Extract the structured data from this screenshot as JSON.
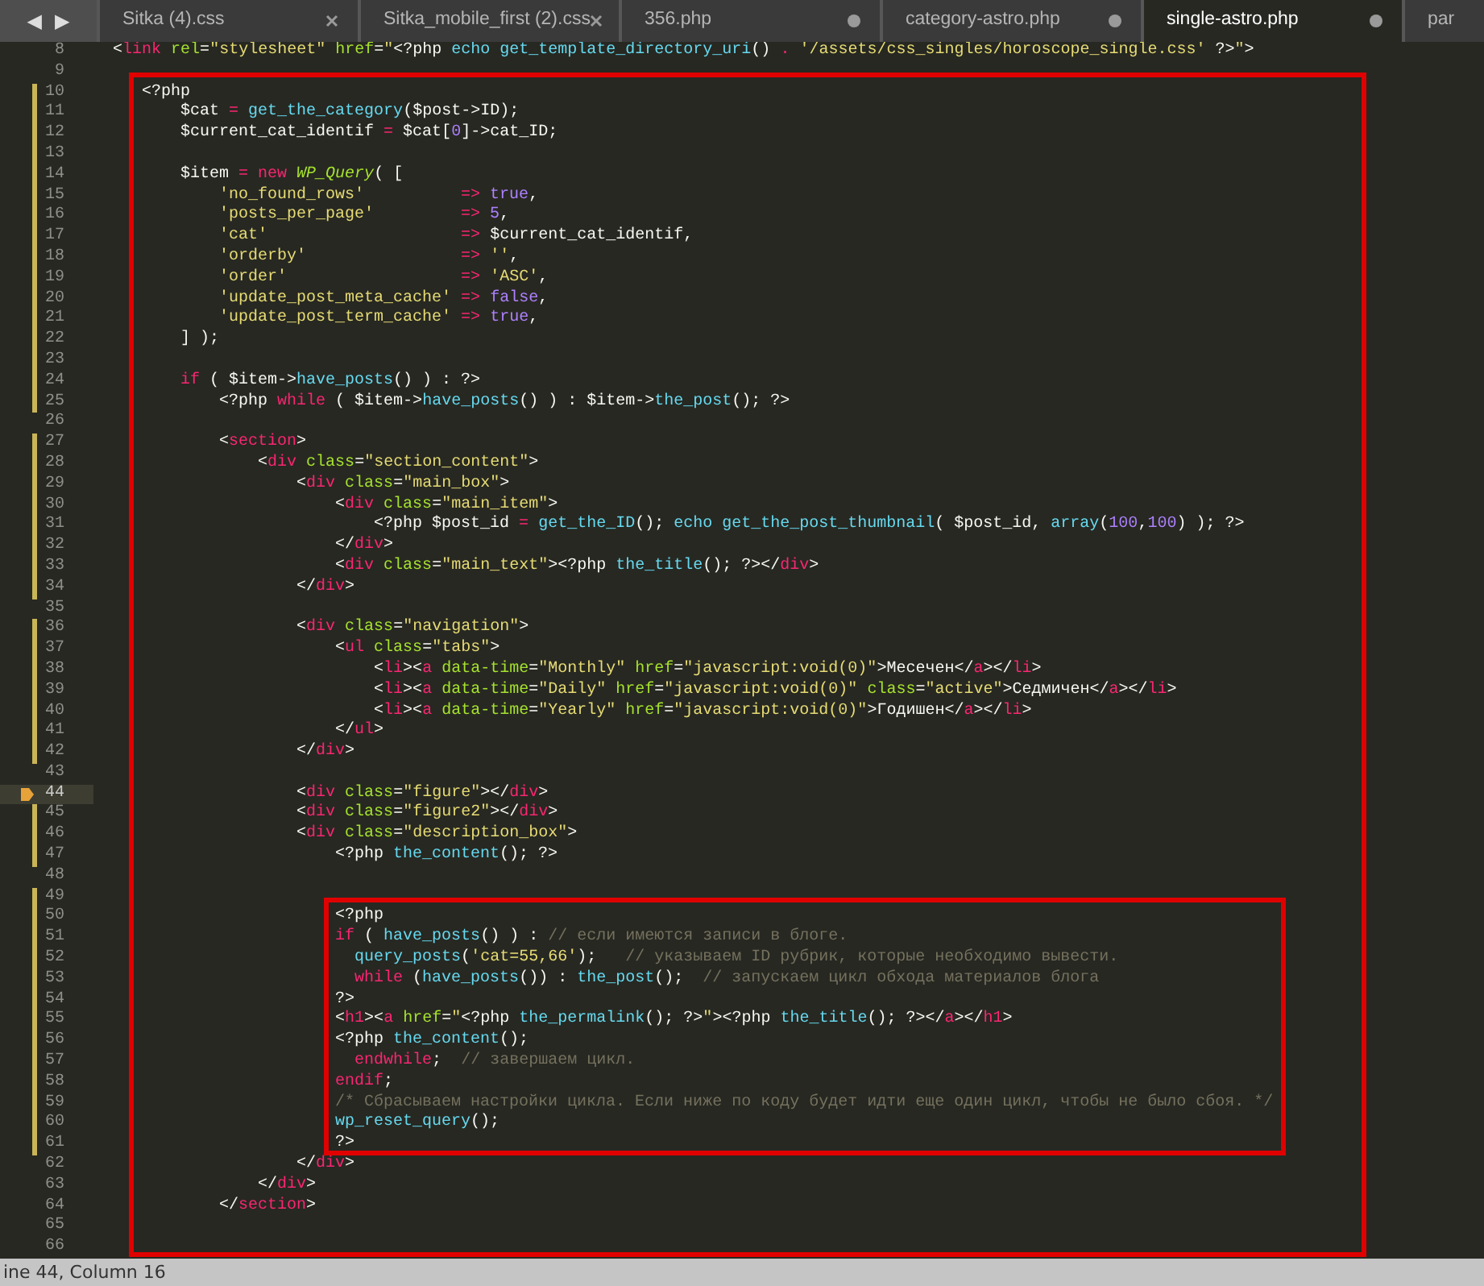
{
  "tab_bar": {
    "nav_arrows": [
      "◀",
      "▶"
    ],
    "tabs": [
      {
        "label": "Sitka (4).css",
        "modified": false,
        "selected": false
      },
      {
        "label": "Sitka_mobile_first (2).css",
        "modified": false,
        "selected": false
      },
      {
        "label": "356.php",
        "modified": true,
        "selected": false
      },
      {
        "label": "category-astro.php",
        "modified": true,
        "selected": false
      },
      {
        "label": "single-astro.php",
        "modified": true,
        "selected": true
      },
      {
        "label": "par",
        "selected": false
      }
    ]
  },
  "editor": {
    "lines": [
      {
        "number": "8",
        "modified": false,
        "current": false,
        "bookmarked": false,
        "frame_starts": false,
        "frame_ends": false,
        "tokens": [
          {
            "kind": "plain",
            "text": "  <"
          },
          {
            "kind": "tag",
            "text": "link"
          },
          {
            "kind": "attr",
            "text": " rel"
          },
          {
            "kind": "plain",
            "text": "="
          },
          {
            "kind": "str",
            "text": "\"stylesheet\""
          },
          {
            "kind": "attr",
            "text": " href"
          },
          {
            "kind": "plain",
            "text": "="
          },
          {
            "kind": "str",
            "text": "\""
          },
          {
            "kind": "plain",
            "text": "<?php "
          },
          {
            "kind": "fn",
            "text": "echo get_template_directory_uri"
          },
          {
            "kind": "plain",
            "text": "() "
          },
          {
            "kind": "op",
            "text": "."
          },
          {
            "kind": "str",
            "text": " '/assets/css_singles/horoscope_single.css'"
          },
          {
            "kind": "plain",
            "text": " ?>"
          },
          {
            "kind": "str",
            "text": "\""
          },
          {
            "kind": "plain",
            "text": ">"
          }
        ]
      },
      {
        "number": "9",
        "modified": false,
        "current": false,
        "bookmarked": false,
        "frame_starts": true,
        "frame_ends": false
      },
      {
        "number": "10",
        "modified": true,
        "current": false,
        "bookmarked": false,
        "frame_starts": false,
        "frame_ends": false,
        "tokens": [
          {
            "kind": "plain",
            "text": "     <?php"
          }
        ]
      },
      {
        "number": "11",
        "modified": true,
        "current": false,
        "bookmarked": false,
        "frame_starts": false,
        "frame_ends": false,
        "tokens": [
          {
            "kind": "plain",
            "text": "         $cat "
          },
          {
            "kind": "op",
            "text": "="
          },
          {
            "kind": "fn",
            "text": " get_the_category"
          },
          {
            "kind": "plain",
            "text": "($post->ID);"
          }
        ]
      },
      {
        "number": "12",
        "modified": true,
        "current": false,
        "bookmarked": false,
        "frame_starts": false,
        "frame_ends": false,
        "tokens": [
          {
            "kind": "plain",
            "text": "         $current_cat_identif "
          },
          {
            "kind": "op",
            "text": "="
          },
          {
            "kind": "plain",
            "text": " $cat["
          },
          {
            "kind": "num",
            "text": "0"
          },
          {
            "kind": "plain",
            "text": "]->cat_ID;"
          }
        ]
      },
      {
        "number": "13",
        "modified": true,
        "current": false,
        "bookmarked": false,
        "frame_starts": false,
        "frame_ends": false
      },
      {
        "number": "14",
        "modified": true,
        "current": false,
        "bookmarked": false,
        "frame_starts": false,
        "frame_ends": false,
        "tokens": [
          {
            "kind": "plain",
            "text": "         $item "
          },
          {
            "kind": "op",
            "text": "="
          },
          {
            "kind": "kw",
            "text": " new"
          },
          {
            "kind": "cls",
            "text": " WP_Query"
          },
          {
            "kind": "plain",
            "text": "( ["
          }
        ]
      },
      {
        "number": "15",
        "modified": true,
        "current": false,
        "bookmarked": false,
        "frame_starts": false,
        "frame_ends": false,
        "tokens": [
          {
            "kind": "str",
            "text": "             'no_found_rows'"
          },
          {
            "kind": "op",
            "text": "          =>"
          },
          {
            "kind": "num",
            "text": " true"
          },
          {
            "kind": "plain",
            "text": ","
          }
        ]
      },
      {
        "number": "16",
        "modified": true,
        "current": false,
        "bookmarked": false,
        "frame_starts": false,
        "frame_ends": false,
        "tokens": [
          {
            "kind": "str",
            "text": "             'posts_per_page'"
          },
          {
            "kind": "op",
            "text": "         =>"
          },
          {
            "kind": "num",
            "text": " 5"
          },
          {
            "kind": "plain",
            "text": ","
          }
        ]
      },
      {
        "number": "17",
        "modified": true,
        "current": false,
        "bookmarked": false,
        "frame_starts": false,
        "frame_ends": false,
        "tokens": [
          {
            "kind": "str",
            "text": "             'cat'"
          },
          {
            "kind": "op",
            "text": "                    =>"
          },
          {
            "kind": "plain",
            "text": " $current_cat_identif,"
          }
        ]
      },
      {
        "number": "18",
        "modified": true,
        "current": false,
        "bookmarked": false,
        "frame_starts": false,
        "frame_ends": false,
        "tokens": [
          {
            "kind": "str",
            "text": "             'orderby'"
          },
          {
            "kind": "op",
            "text": "                =>"
          },
          {
            "kind": "str",
            "text": " ''"
          },
          {
            "kind": "plain",
            "text": ","
          }
        ]
      },
      {
        "number": "19",
        "modified": true,
        "current": false,
        "bookmarked": false,
        "frame_starts": false,
        "frame_ends": false,
        "tokens": [
          {
            "kind": "str",
            "text": "             'order'"
          },
          {
            "kind": "op",
            "text": "                  =>"
          },
          {
            "kind": "str",
            "text": " 'ASC'"
          },
          {
            "kind": "plain",
            "text": ","
          }
        ]
      },
      {
        "number": "20",
        "modified": true,
        "current": false,
        "bookmarked": false,
        "frame_starts": false,
        "frame_ends": false,
        "tokens": [
          {
            "kind": "str",
            "text": "             'update_post_meta_cache'"
          },
          {
            "kind": "op",
            "text": " =>"
          },
          {
            "kind": "num",
            "text": " false"
          },
          {
            "kind": "plain",
            "text": ","
          }
        ]
      },
      {
        "number": "21",
        "modified": true,
        "current": false,
        "bookmarked": false,
        "frame_starts": false,
        "frame_ends": false,
        "tokens": [
          {
            "kind": "str",
            "text": "             'update_post_term_cache'"
          },
          {
            "kind": "op",
            "text": " =>"
          },
          {
            "kind": "num",
            "text": " true"
          },
          {
            "kind": "plain",
            "text": ","
          }
        ]
      },
      {
        "number": "22",
        "modified": true,
        "current": false,
        "bookmarked": false,
        "frame_starts": false,
        "frame_ends": false,
        "tokens": [
          {
            "kind": "plain",
            "text": "         ] );"
          }
        ]
      },
      {
        "number": "23",
        "modified": true,
        "current": false,
        "bookmarked": false,
        "frame_starts": false,
        "frame_ends": false
      },
      {
        "number": "24",
        "modified": true,
        "current": false,
        "bookmarked": false,
        "frame_starts": false,
        "frame_ends": false,
        "tokens": [
          {
            "kind": "kw",
            "text": "         if"
          },
          {
            "kind": "plain",
            "text": " ( $item->"
          },
          {
            "kind": "fn",
            "text": "have_posts"
          },
          {
            "kind": "plain",
            "text": "() ) : ?>"
          }
        ]
      },
      {
        "number": "25",
        "modified": true,
        "current": false,
        "bookmarked": false,
        "frame_starts": false,
        "frame_ends": false,
        "tokens": [
          {
            "kind": "plain",
            "text": "             <?php "
          },
          {
            "kind": "kw",
            "text": "while"
          },
          {
            "kind": "plain",
            "text": " ( $item->"
          },
          {
            "kind": "fn",
            "text": "have_posts"
          },
          {
            "kind": "plain",
            "text": "() ) : $item->"
          },
          {
            "kind": "fn",
            "text": "the_post"
          },
          {
            "kind": "plain",
            "text": "(); ?>"
          }
        ]
      },
      {
        "number": "26",
        "modified": false,
        "current": false,
        "bookmarked": false,
        "frame_starts": false,
        "frame_ends": false
      },
      {
        "number": "27",
        "modified": true,
        "current": false,
        "bookmarked": false,
        "frame_starts": false,
        "frame_ends": false,
        "tokens": [
          {
            "kind": "plain",
            "text": "             <"
          },
          {
            "kind": "tag",
            "text": "section"
          },
          {
            "kind": "plain",
            "text": ">"
          }
        ]
      },
      {
        "number": "28",
        "modified": true,
        "current": false,
        "bookmarked": false,
        "frame_starts": false,
        "frame_ends": false,
        "tokens": [
          {
            "kind": "plain",
            "text": "                 <"
          },
          {
            "kind": "tag",
            "text": "div"
          },
          {
            "kind": "attr",
            "text": " class"
          },
          {
            "kind": "plain",
            "text": "="
          },
          {
            "kind": "str",
            "text": "\"section_content\""
          },
          {
            "kind": "plain",
            "text": ">"
          }
        ]
      },
      {
        "number": "29",
        "modified": true,
        "current": false,
        "bookmarked": false,
        "frame_starts": false,
        "frame_ends": false,
        "tokens": [
          {
            "kind": "plain",
            "text": "                     <"
          },
          {
            "kind": "tag",
            "text": "div"
          },
          {
            "kind": "attr",
            "text": " class"
          },
          {
            "kind": "plain",
            "text": "="
          },
          {
            "kind": "str",
            "text": "\"main_box\""
          },
          {
            "kind": "plain",
            "text": ">"
          }
        ]
      },
      {
        "number": "30",
        "modified": true,
        "current": false,
        "bookmarked": false,
        "frame_starts": false,
        "frame_ends": false,
        "tokens": [
          {
            "kind": "plain",
            "text": "                         <"
          },
          {
            "kind": "tag",
            "text": "div"
          },
          {
            "kind": "attr",
            "text": " class"
          },
          {
            "kind": "plain",
            "text": "="
          },
          {
            "kind": "str",
            "text": "\"main_item\""
          },
          {
            "kind": "plain",
            "text": ">"
          }
        ]
      },
      {
        "number": "31",
        "modified": true,
        "current": false,
        "bookmarked": false,
        "frame_starts": false,
        "frame_ends": false,
        "tokens": [
          {
            "kind": "plain",
            "text": "                             <?php $post_id "
          },
          {
            "kind": "op",
            "text": "="
          },
          {
            "kind": "fn",
            "text": " get_the_ID"
          },
          {
            "kind": "plain",
            "text": "(); "
          },
          {
            "kind": "fn",
            "text": "echo get_the_post_thumbnail"
          },
          {
            "kind": "plain",
            "text": "( $post_id, "
          },
          {
            "kind": "fn",
            "text": "array"
          },
          {
            "kind": "plain",
            "text": "("
          },
          {
            "kind": "num",
            "text": "100"
          },
          {
            "kind": "plain",
            "text": ","
          },
          {
            "kind": "num",
            "text": "100"
          },
          {
            "kind": "plain",
            "text": ") ); ?>"
          }
        ]
      },
      {
        "number": "32",
        "modified": true,
        "current": false,
        "bookmarked": false,
        "frame_starts": false,
        "frame_ends": false,
        "tokens": [
          {
            "kind": "plain",
            "text": "                         </"
          },
          {
            "kind": "tag",
            "text": "div"
          },
          {
            "kind": "plain",
            "text": ">"
          }
        ]
      },
      {
        "number": "33",
        "modified": true,
        "current": false,
        "bookmarked": false,
        "frame_starts": false,
        "frame_ends": false,
        "tokens": [
          {
            "kind": "plain",
            "text": "                         <"
          },
          {
            "kind": "tag",
            "text": "div"
          },
          {
            "kind": "attr",
            "text": " class"
          },
          {
            "kind": "plain",
            "text": "="
          },
          {
            "kind": "str",
            "text": "\"main_text\""
          },
          {
            "kind": "plain",
            "text": "><?php "
          },
          {
            "kind": "fn",
            "text": "the_title"
          },
          {
            "kind": "plain",
            "text": "(); ?></"
          },
          {
            "kind": "tag",
            "text": "div"
          },
          {
            "kind": "plain",
            "text": ">"
          }
        ]
      },
      {
        "number": "34",
        "modified": true,
        "current": false,
        "bookmarked": false,
        "frame_starts": false,
        "frame_ends": false,
        "tokens": [
          {
            "kind": "plain",
            "text": "                     </"
          },
          {
            "kind": "tag",
            "text": "div"
          },
          {
            "kind": "plain",
            "text": ">"
          }
        ]
      },
      {
        "number": "35",
        "modified": false,
        "current": false,
        "bookmarked": false,
        "frame_starts": false,
        "frame_ends": false
      },
      {
        "number": "36",
        "modified": true,
        "current": false,
        "bookmarked": false,
        "frame_starts": false,
        "frame_ends": false,
        "tokens": [
          {
            "kind": "plain",
            "text": "                     <"
          },
          {
            "kind": "tag",
            "text": "div"
          },
          {
            "kind": "attr",
            "text": " class"
          },
          {
            "kind": "plain",
            "text": "="
          },
          {
            "kind": "str",
            "text": "\"navigation\""
          },
          {
            "kind": "plain",
            "text": ">"
          }
        ]
      },
      {
        "number": "37",
        "modified": true,
        "current": false,
        "bookmarked": false,
        "frame_starts": false,
        "frame_ends": false,
        "tokens": [
          {
            "kind": "plain",
            "text": "                         <"
          },
          {
            "kind": "tag",
            "text": "ul"
          },
          {
            "kind": "attr",
            "text": " class"
          },
          {
            "kind": "plain",
            "text": "="
          },
          {
            "kind": "str",
            "text": "\"tabs\""
          },
          {
            "kind": "plain",
            "text": ">"
          }
        ]
      },
      {
        "number": "38",
        "modified": true,
        "current": false,
        "bookmarked": false,
        "frame_starts": false,
        "frame_ends": false,
        "tokens": [
          {
            "kind": "plain",
            "text": "                             <"
          },
          {
            "kind": "tag",
            "text": "li"
          },
          {
            "kind": "plain",
            "text": "><"
          },
          {
            "kind": "tag",
            "text": "a"
          },
          {
            "kind": "attr",
            "text": " data-time"
          },
          {
            "kind": "plain",
            "text": "="
          },
          {
            "kind": "str",
            "text": "\"Monthly\""
          },
          {
            "kind": "attr",
            "text": " href"
          },
          {
            "kind": "plain",
            "text": "="
          },
          {
            "kind": "str",
            "text": "\"javascript:void(0)\""
          },
          {
            "kind": "plain",
            "text": ">Месечен</"
          },
          {
            "kind": "tag",
            "text": "a"
          },
          {
            "kind": "plain",
            "text": "></"
          },
          {
            "kind": "tag",
            "text": "li"
          },
          {
            "kind": "plain",
            "text": ">"
          }
        ]
      },
      {
        "number": "39",
        "modified": true,
        "current": false,
        "bookmarked": false,
        "frame_starts": false,
        "frame_ends": false,
        "tokens": [
          {
            "kind": "plain",
            "text": "                             <"
          },
          {
            "kind": "tag",
            "text": "li"
          },
          {
            "kind": "plain",
            "text": "><"
          },
          {
            "kind": "tag",
            "text": "a"
          },
          {
            "kind": "attr",
            "text": " data-time"
          },
          {
            "kind": "plain",
            "text": "="
          },
          {
            "kind": "str",
            "text": "\"Daily\""
          },
          {
            "kind": "attr",
            "text": " href"
          },
          {
            "kind": "plain",
            "text": "="
          },
          {
            "kind": "str",
            "text": "\"javascript:void(0)\""
          },
          {
            "kind": "attr",
            "text": " class"
          },
          {
            "kind": "plain",
            "text": "="
          },
          {
            "kind": "str",
            "text": "\"active\""
          },
          {
            "kind": "plain",
            "text": ">Седмичен</"
          },
          {
            "kind": "tag",
            "text": "a"
          },
          {
            "kind": "plain",
            "text": "></"
          },
          {
            "kind": "tag",
            "text": "li"
          },
          {
            "kind": "plain",
            "text": ">"
          }
        ]
      },
      {
        "number": "40",
        "modified": true,
        "current": false,
        "bookmarked": false,
        "frame_starts": false,
        "frame_ends": false,
        "tokens": [
          {
            "kind": "plain",
            "text": "                             <"
          },
          {
            "kind": "tag",
            "text": "li"
          },
          {
            "kind": "plain",
            "text": "><"
          },
          {
            "kind": "tag",
            "text": "a"
          },
          {
            "kind": "attr",
            "text": " data-time"
          },
          {
            "kind": "plain",
            "text": "="
          },
          {
            "kind": "str",
            "text": "\"Yearly\""
          },
          {
            "kind": "attr",
            "text": " href"
          },
          {
            "kind": "plain",
            "text": "="
          },
          {
            "kind": "str",
            "text": "\"javascript:void(0)\""
          },
          {
            "kind": "plain",
            "text": ">Годишен</"
          },
          {
            "kind": "tag",
            "text": "a"
          },
          {
            "kind": "plain",
            "text": "></"
          },
          {
            "kind": "tag",
            "text": "li"
          },
          {
            "kind": "plain",
            "text": ">"
          }
        ]
      },
      {
        "number": "41",
        "modified": true,
        "current": false,
        "bookmarked": false,
        "frame_starts": false,
        "frame_ends": false,
        "tokens": [
          {
            "kind": "plain",
            "text": "                         </"
          },
          {
            "kind": "tag",
            "text": "ul"
          },
          {
            "kind": "plain",
            "text": ">"
          }
        ]
      },
      {
        "number": "42",
        "modified": true,
        "current": false,
        "bookmarked": false,
        "frame_starts": false,
        "frame_ends": false,
        "tokens": [
          {
            "kind": "plain",
            "text": "                     </"
          },
          {
            "kind": "tag",
            "text": "div"
          },
          {
            "kind": "plain",
            "text": ">"
          }
        ]
      },
      {
        "number": "43",
        "modified": false,
        "current": false,
        "bookmarked": false,
        "frame_starts": false,
        "frame_ends": false
      },
      {
        "number": "44",
        "modified": false,
        "current": true,
        "bookmarked": true,
        "frame_starts": false,
        "frame_ends": false,
        "tokens": [
          {
            "kind": "plain",
            "text": "                     <"
          },
          {
            "kind": "tag",
            "text": "div"
          },
          {
            "kind": "attr",
            "text": " class"
          },
          {
            "kind": "plain",
            "text": "="
          },
          {
            "kind": "str",
            "text": "\"figure\""
          },
          {
            "kind": "plain",
            "text": "></"
          },
          {
            "kind": "tag",
            "text": "div"
          },
          {
            "kind": "plain",
            "text": ">"
          }
        ]
      },
      {
        "number": "45",
        "modified": true,
        "current": false,
        "bookmarked": false,
        "frame_starts": false,
        "frame_ends": false,
        "tokens": [
          {
            "kind": "plain",
            "text": "                     <"
          },
          {
            "kind": "tag",
            "text": "div"
          },
          {
            "kind": "attr",
            "text": " class"
          },
          {
            "kind": "plain",
            "text": "="
          },
          {
            "kind": "str",
            "text": "\"figure2\""
          },
          {
            "kind": "plain",
            "text": "></"
          },
          {
            "kind": "tag",
            "text": "div"
          },
          {
            "kind": "plain",
            "text": ">"
          }
        ]
      },
      {
        "number": "46",
        "modified": true,
        "current": false,
        "bookmarked": false,
        "frame_starts": false,
        "frame_ends": false,
        "tokens": [
          {
            "kind": "plain",
            "text": "                     <"
          },
          {
            "kind": "tag",
            "text": "div"
          },
          {
            "kind": "attr",
            "text": " class"
          },
          {
            "kind": "plain",
            "text": "="
          },
          {
            "kind": "str",
            "text": "\"description_box\""
          },
          {
            "kind": "plain",
            "text": ">"
          }
        ]
      },
      {
        "number": "47",
        "modified": true,
        "current": false,
        "bookmarked": false,
        "frame_starts": false,
        "frame_ends": false,
        "tokens": [
          {
            "kind": "plain",
            "text": "                         <?php "
          },
          {
            "kind": "fn",
            "text": "the_content"
          },
          {
            "kind": "plain",
            "text": "(); ?>"
          }
        ]
      },
      {
        "number": "48",
        "modified": false,
        "current": false,
        "bookmarked": false,
        "frame_starts": false,
        "frame_ends": false
      },
      {
        "number": "49",
        "modified": true,
        "current": false,
        "bookmarked": false,
        "frame_starts": true,
        "frame_ends": false
      },
      {
        "number": "50",
        "modified": true,
        "current": false,
        "bookmarked": false,
        "frame_starts": false,
        "frame_ends": false,
        "tokens": [
          {
            "kind": "plain",
            "text": "                         <?php"
          }
        ]
      },
      {
        "number": "51",
        "modified": true,
        "current": false,
        "bookmarked": false,
        "frame_starts": false,
        "frame_ends": false,
        "tokens": [
          {
            "kind": "kw",
            "text": "                         if"
          },
          {
            "kind": "plain",
            "text": " ( "
          },
          {
            "kind": "fn",
            "text": "have_posts"
          },
          {
            "kind": "plain",
            "text": "() ) : "
          },
          {
            "kind": "cmt",
            "text": "// если имеются записи в блоге."
          }
        ]
      },
      {
        "number": "52",
        "modified": true,
        "current": false,
        "bookmarked": false,
        "frame_starts": false,
        "frame_ends": false,
        "tokens": [
          {
            "kind": "fn",
            "text": "                           query_posts"
          },
          {
            "kind": "plain",
            "text": "("
          },
          {
            "kind": "str",
            "text": "'cat=55,66'"
          },
          {
            "kind": "plain",
            "text": ");   "
          },
          {
            "kind": "cmt",
            "text": "// указываем ID рубрик, которые необходимо вывести."
          }
        ]
      },
      {
        "number": "53",
        "modified": true,
        "current": false,
        "bookmarked": false,
        "frame_starts": false,
        "frame_ends": false,
        "tokens": [
          {
            "kind": "kw",
            "text": "                           while"
          },
          {
            "kind": "plain",
            "text": " ("
          },
          {
            "kind": "fn",
            "text": "have_posts"
          },
          {
            "kind": "plain",
            "text": "()) : "
          },
          {
            "kind": "fn",
            "text": "the_post"
          },
          {
            "kind": "plain",
            "text": "();  "
          },
          {
            "kind": "cmt",
            "text": "// запускаем цикл обхода материалов блога"
          }
        ]
      },
      {
        "number": "54",
        "modified": true,
        "current": false,
        "bookmarked": false,
        "frame_starts": false,
        "frame_ends": false,
        "tokens": [
          {
            "kind": "plain",
            "text": "                         ?>"
          }
        ]
      },
      {
        "number": "55",
        "modified": true,
        "current": false,
        "bookmarked": false,
        "frame_starts": false,
        "frame_ends": false,
        "tokens": [
          {
            "kind": "plain",
            "text": "                         <"
          },
          {
            "kind": "tag",
            "text": "h1"
          },
          {
            "kind": "plain",
            "text": "><"
          },
          {
            "kind": "tag",
            "text": "a"
          },
          {
            "kind": "attr",
            "text": " href"
          },
          {
            "kind": "plain",
            "text": "="
          },
          {
            "kind": "str",
            "text": "\""
          },
          {
            "kind": "plain",
            "text": "<?php "
          },
          {
            "kind": "fn",
            "text": "the_permalink"
          },
          {
            "kind": "plain",
            "text": "(); ?>"
          },
          {
            "kind": "str",
            "text": "\""
          },
          {
            "kind": "plain",
            "text": "><?php "
          },
          {
            "kind": "fn",
            "text": "the_title"
          },
          {
            "kind": "plain",
            "text": "(); ?></"
          },
          {
            "kind": "tag",
            "text": "a"
          },
          {
            "kind": "plain",
            "text": "></"
          },
          {
            "kind": "tag",
            "text": "h1"
          },
          {
            "kind": "plain",
            "text": ">"
          }
        ]
      },
      {
        "number": "56",
        "modified": true,
        "current": false,
        "bookmarked": false,
        "frame_starts": false,
        "frame_ends": false,
        "tokens": [
          {
            "kind": "plain",
            "text": "                         <?php "
          },
          {
            "kind": "fn",
            "text": "the_content"
          },
          {
            "kind": "plain",
            "text": "();"
          }
        ]
      },
      {
        "number": "57",
        "modified": true,
        "current": false,
        "bookmarked": false,
        "frame_starts": false,
        "frame_ends": false,
        "tokens": [
          {
            "kind": "kw",
            "text": "                           endwhile"
          },
          {
            "kind": "plain",
            "text": ";  "
          },
          {
            "kind": "cmt",
            "text": "// завершаем цикл."
          }
        ]
      },
      {
        "number": "58",
        "modified": true,
        "current": false,
        "bookmarked": false,
        "frame_starts": false,
        "frame_ends": false,
        "tokens": [
          {
            "kind": "kw",
            "text": "                         endif"
          },
          {
            "kind": "plain",
            "text": ";"
          }
        ]
      },
      {
        "number": "59",
        "modified": true,
        "current": false,
        "bookmarked": false,
        "frame_starts": false,
        "frame_ends": false,
        "tokens": [
          {
            "kind": "cmt",
            "text": "                         /* Сбрасываем настройки цикла. Если ниже по коду будет идти еще один цикл, чтобы не было сбоя. */"
          }
        ]
      },
      {
        "number": "60",
        "modified": true,
        "current": false,
        "bookmarked": false,
        "frame_starts": false,
        "frame_ends": false,
        "tokens": [
          {
            "kind": "fn",
            "text": "                         wp_reset_query"
          },
          {
            "kind": "plain",
            "text": "();"
          }
        ]
      },
      {
        "number": "61",
        "modified": true,
        "current": false,
        "bookmarked": false,
        "frame_starts": false,
        "frame_ends": true,
        "tokens": [
          {
            "kind": "plain",
            "text": "                         ?>"
          }
        ]
      },
      {
        "number": "62",
        "modified": false,
        "current": false,
        "bookmarked": false,
        "frame_starts": false,
        "frame_ends": false,
        "tokens": [
          {
            "kind": "plain",
            "text": "                     </"
          },
          {
            "kind": "tag",
            "text": "div"
          },
          {
            "kind": "plain",
            "text": ">"
          }
        ]
      },
      {
        "number": "63",
        "modified": false,
        "current": false,
        "bookmarked": false,
        "frame_starts": false,
        "frame_ends": false,
        "tokens": [
          {
            "kind": "plain",
            "text": "                 </"
          },
          {
            "kind": "tag",
            "text": "div"
          },
          {
            "kind": "plain",
            "text": ">"
          }
        ]
      },
      {
        "number": "64",
        "modified": false,
        "current": false,
        "bookmarked": false,
        "frame_starts": false,
        "frame_ends": false,
        "tokens": [
          {
            "kind": "plain",
            "text": "             </"
          },
          {
            "kind": "tag",
            "text": "section"
          },
          {
            "kind": "plain",
            "text": ">"
          }
        ]
      },
      {
        "number": "65",
        "modified": false,
        "current": false,
        "bookmarked": false,
        "frame_starts": false,
        "frame_ends": false
      },
      {
        "number": "66",
        "modified": false,
        "current": false,
        "bookmarked": false,
        "frame_starts": false,
        "frame_ends": true
      }
    ]
  },
  "status_bar": {
    "text": "ine 44, Column 16"
  }
}
